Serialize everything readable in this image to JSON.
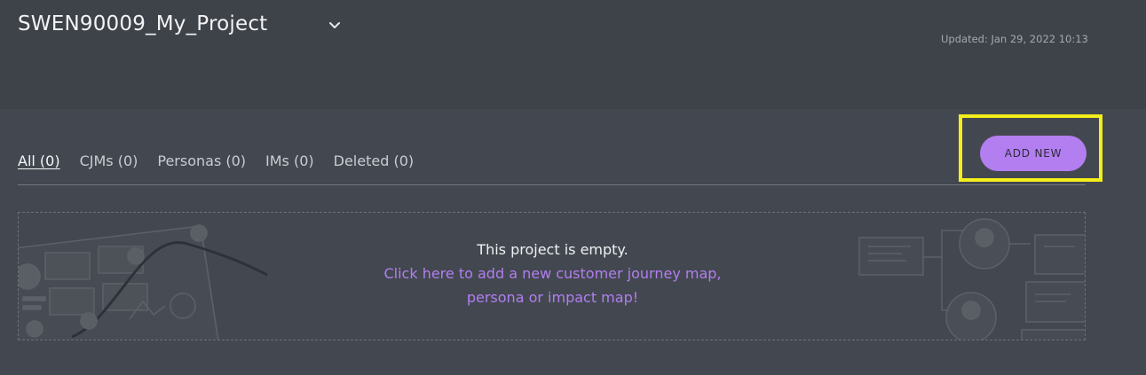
{
  "header": {
    "project_title": "SWEN90009_My_Project",
    "updated": "Updated: Jan 29, 2022 10:13"
  },
  "tabs": [
    {
      "label": "All (0)",
      "active": true
    },
    {
      "label": "CJMs (0)",
      "active": false
    },
    {
      "label": "Personas (0)",
      "active": false
    },
    {
      "label": "IMs (0)",
      "active": false
    },
    {
      "label": "Deleted (0)",
      "active": false
    }
  ],
  "actions": {
    "add_new_label": "ADD NEW"
  },
  "empty_state": {
    "title": "This project is empty.",
    "link_line1": "Click here to add a new customer journey map,",
    "link_line2": "persona or impact map!"
  },
  "colors": {
    "background": "#434850",
    "header_background": "#3e4249",
    "accent": "#b27ef0",
    "highlight": "#f4ee1a"
  },
  "icons": [
    "chevron-down-icon"
  ]
}
